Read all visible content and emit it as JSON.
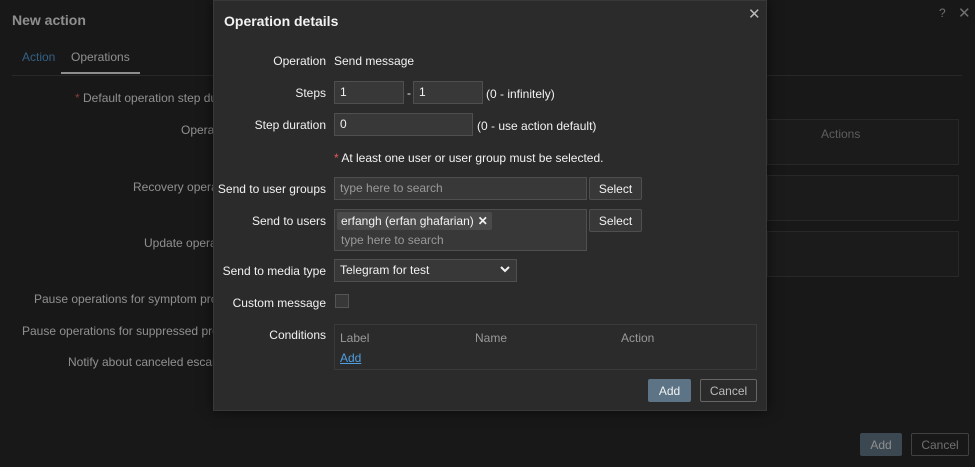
{
  "background": {
    "title": "New action",
    "help_label": "?",
    "close_label": "✕",
    "tabs": [
      {
        "label": "Action"
      },
      {
        "label": "Operations"
      }
    ],
    "labels": {
      "default_step_duration": "Default operation step dura",
      "operations": "Operat",
      "recovery_operations": "Recovery operat",
      "update_operations": "Update operat",
      "pause_symptom": "Pause operations for symptom probl",
      "pause_suppressed": "Pause operations for suppressed probl",
      "notify_canceled": "Notify about canceled escalat"
    },
    "actions_header": "Actions",
    "add_label": "Add",
    "cancel_label": "Cancel"
  },
  "modal": {
    "title": "Operation details",
    "close_label": "✕",
    "operation_label": "Operation",
    "operation_value": "Send message",
    "steps_label": "Steps",
    "steps_from": "1",
    "steps_sep": "-",
    "steps_to": "1",
    "steps_hint": "(0 - infinitely)",
    "step_duration_label": "Step duration",
    "step_duration_value": "0",
    "step_duration_hint": "(0 - use action default)",
    "requirement_note": "At least one user or user group must be selected.",
    "user_groups_label": "Send to user groups",
    "user_groups_placeholder": "type here to search",
    "select_label": "Select",
    "users_label": "Send to users",
    "selected_user": "erfangh (erfan ghafarian)",
    "users_placeholder": "type here to search",
    "media_type_label": "Send to media type",
    "media_type_value": "Telegram for test",
    "custom_message_label": "Custom message",
    "custom_message_checked": false,
    "conditions_label": "Conditions",
    "conditions_columns": [
      "Label",
      "Name",
      "Action"
    ],
    "conditions_add": "Add",
    "add_button": "Add",
    "cancel_button": "Cancel"
  }
}
